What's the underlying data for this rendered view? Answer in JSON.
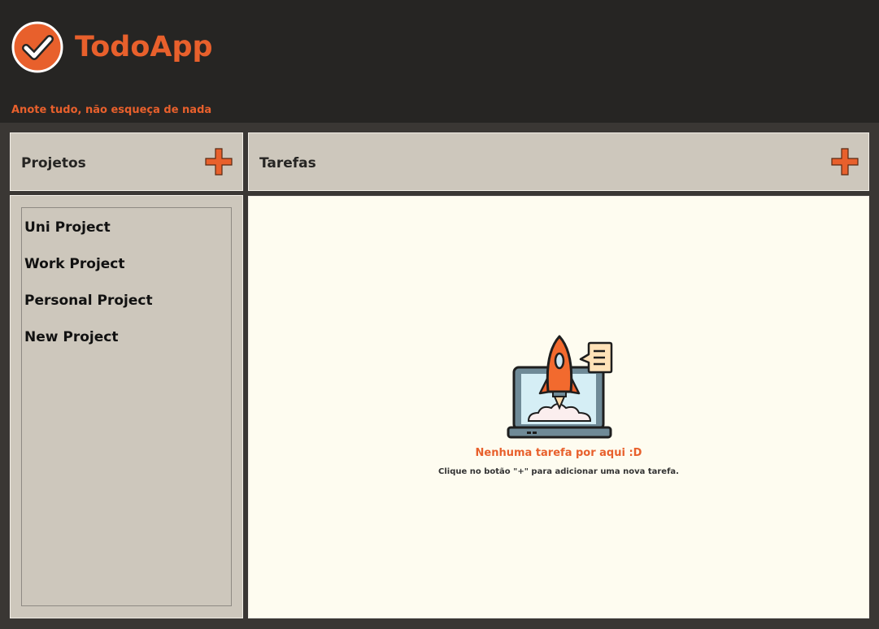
{
  "app": {
    "title": "TodoApp",
    "tagline": "Anote tudo, não esqueça de nada",
    "logo_icon": "checkmark-circle-icon",
    "accent_color": "#e8602c"
  },
  "projects": {
    "title": "Projetos",
    "add_icon": "plus-icon",
    "items": [
      {
        "label": "Uni Project"
      },
      {
        "label": "Work Project"
      },
      {
        "label": "Personal Project"
      },
      {
        "label": "New Project"
      }
    ]
  },
  "tasks": {
    "title": "Tarefas",
    "add_icon": "plus-icon",
    "empty_icon": "rocket-laptop-icon",
    "empty_title": "Nenhuma tarefa por aqui :D",
    "empty_subtitle": "Clique no botão \"+\" para adicionar uma nova tarefa."
  }
}
